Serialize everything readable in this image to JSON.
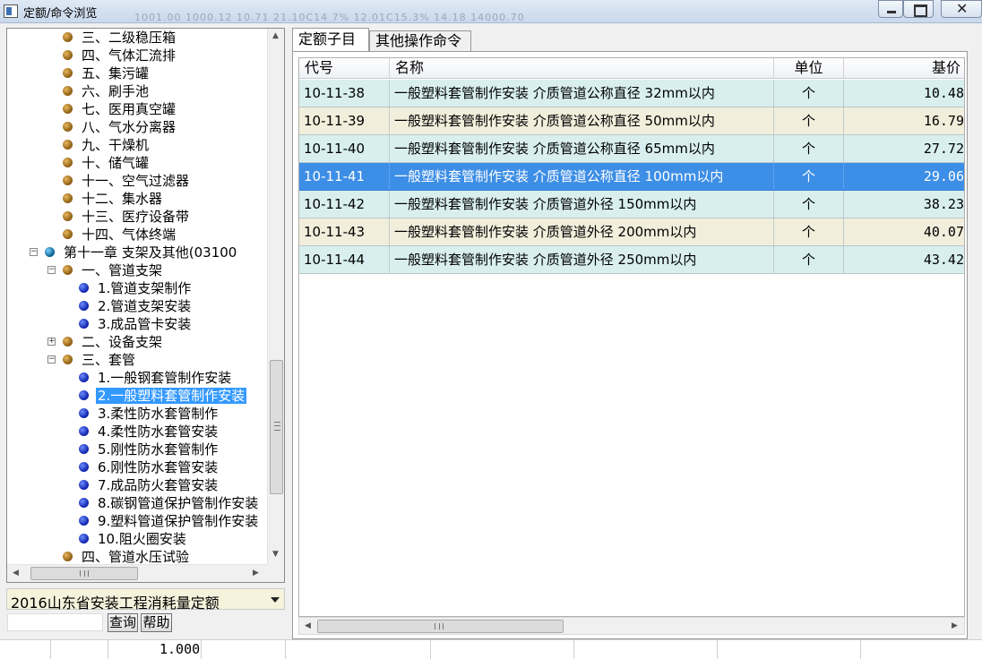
{
  "window": {
    "title": "定额/命令浏览",
    "ghost_text": "1001.00    1000.12         10.71     21.10C14 7%   12.01C15.3%          14.18    14000.70"
  },
  "tree": {
    "items": [
      {
        "label": "三、二级稳压箱",
        "bullet": "brown",
        "indent": 2
      },
      {
        "label": "四、气体汇流排",
        "bullet": "brown",
        "indent": 2
      },
      {
        "label": "五、集污罐",
        "bullet": "brown",
        "indent": 2
      },
      {
        "label": "六、刷手池",
        "bullet": "brown",
        "indent": 2
      },
      {
        "label": "七、医用真空罐",
        "bullet": "brown",
        "indent": 2
      },
      {
        "label": "八、气水分离器",
        "bullet": "brown",
        "indent": 2
      },
      {
        "label": "九、干燥机",
        "bullet": "brown",
        "indent": 2
      },
      {
        "label": "十、储气罐",
        "bullet": "brown",
        "indent": 2
      },
      {
        "label": "十一、空气过滤器",
        "bullet": "brown",
        "indent": 2
      },
      {
        "label": "十二、集水器",
        "bullet": "brown",
        "indent": 2
      },
      {
        "label": "十三、医疗设备带",
        "bullet": "brown",
        "indent": 2
      },
      {
        "label": "十四、气体终端",
        "bullet": "brown",
        "indent": 2
      },
      {
        "label": "第十一章 支架及其他(03100",
        "bullet": "teal",
        "indent": 1,
        "expander": "−"
      },
      {
        "label": "一、管道支架",
        "bullet": "brown",
        "indent": 2,
        "expander": "−"
      },
      {
        "label": "1.管道支架制作",
        "bullet": "blue",
        "indent": 3
      },
      {
        "label": "2.管道支架安装",
        "bullet": "blue",
        "indent": 3
      },
      {
        "label": "3.成品管卡安装",
        "bullet": "blue",
        "indent": 3
      },
      {
        "label": "二、设备支架",
        "bullet": "brown",
        "indent": 2,
        "expander": "+"
      },
      {
        "label": "三、套管",
        "bullet": "brown",
        "indent": 2,
        "expander": "−"
      },
      {
        "label": "1.一般钢套管制作安装",
        "bullet": "blue",
        "indent": 3
      },
      {
        "label": "2.一般塑料套管制作安装",
        "bullet": "blue",
        "indent": 3,
        "selected": true
      },
      {
        "label": "3.柔性防水套管制作",
        "bullet": "blue",
        "indent": 3
      },
      {
        "label": "4.柔性防水套管安装",
        "bullet": "blue",
        "indent": 3
      },
      {
        "label": "5.刚性防水套管制作",
        "bullet": "blue",
        "indent": 3
      },
      {
        "label": "6.刚性防水套管安装",
        "bullet": "blue",
        "indent": 3
      },
      {
        "label": "7.成品防火套管安装",
        "bullet": "blue",
        "indent": 3
      },
      {
        "label": "8.碳钢管道保护管制作安装",
        "bullet": "blue",
        "indent": 3
      },
      {
        "label": "9.塑料管道保护管制作安装",
        "bullet": "blue",
        "indent": 3
      },
      {
        "label": "10.阻火圈安装",
        "bullet": "blue",
        "indent": 3
      },
      {
        "label": "四、管道水压试验",
        "bullet": "brown",
        "indent": 2
      }
    ]
  },
  "quota_select": {
    "value": "2016山东省安装工程消耗量定额"
  },
  "buttons": {
    "query": "查询",
    "help": "帮助"
  },
  "tabs": [
    {
      "label": "定额子目",
      "active": true
    },
    {
      "label": "其他操作命令",
      "active": false
    }
  ],
  "grid": {
    "columns": [
      "代号",
      "名称",
      "单位",
      "基价"
    ],
    "rows": [
      {
        "code": "10-11-38",
        "name": "一般塑料套管制作安装 介质管道公称直径 32mm以内",
        "unit": "个",
        "price": "10.48",
        "bg": "#d9efef"
      },
      {
        "code": "10-11-39",
        "name": "一般塑料套管制作安装 介质管道公称直径 50mm以内",
        "unit": "个",
        "price": "16.79",
        "bg": "#f1eedc"
      },
      {
        "code": "10-11-40",
        "name": "一般塑料套管制作安装 介质管道公称直径 65mm以内",
        "unit": "个",
        "price": "27.72",
        "bg": "#d9efef"
      },
      {
        "code": "10-11-41",
        "name": "一般塑料套管制作安装 介质管道公称直径 100mm以内",
        "unit": "个",
        "price": "29.06",
        "bg": "#3d8ee6",
        "selected": true
      },
      {
        "code": "10-11-42",
        "name": "一般塑料套管制作安装 介质管道外径 150mm以内",
        "unit": "个",
        "price": "38.23",
        "bg": "#d9efef"
      },
      {
        "code": "10-11-43",
        "name": "一般塑料套管制作安装 介质管道外径 200mm以内",
        "unit": "个",
        "price": "40.07",
        "bg": "#f1eedc"
      },
      {
        "code": "10-11-44",
        "name": "一般塑料套管制作安装 介质管道外径 250mm以内",
        "unit": "个",
        "price": "43.42",
        "bg": "#d9efef"
      }
    ]
  },
  "bottom": {
    "value": "1.000"
  },
  "icons": {
    "tree_bullet_chapter": "globe-icon",
    "tree_bullet_section": "ball-icon"
  }
}
